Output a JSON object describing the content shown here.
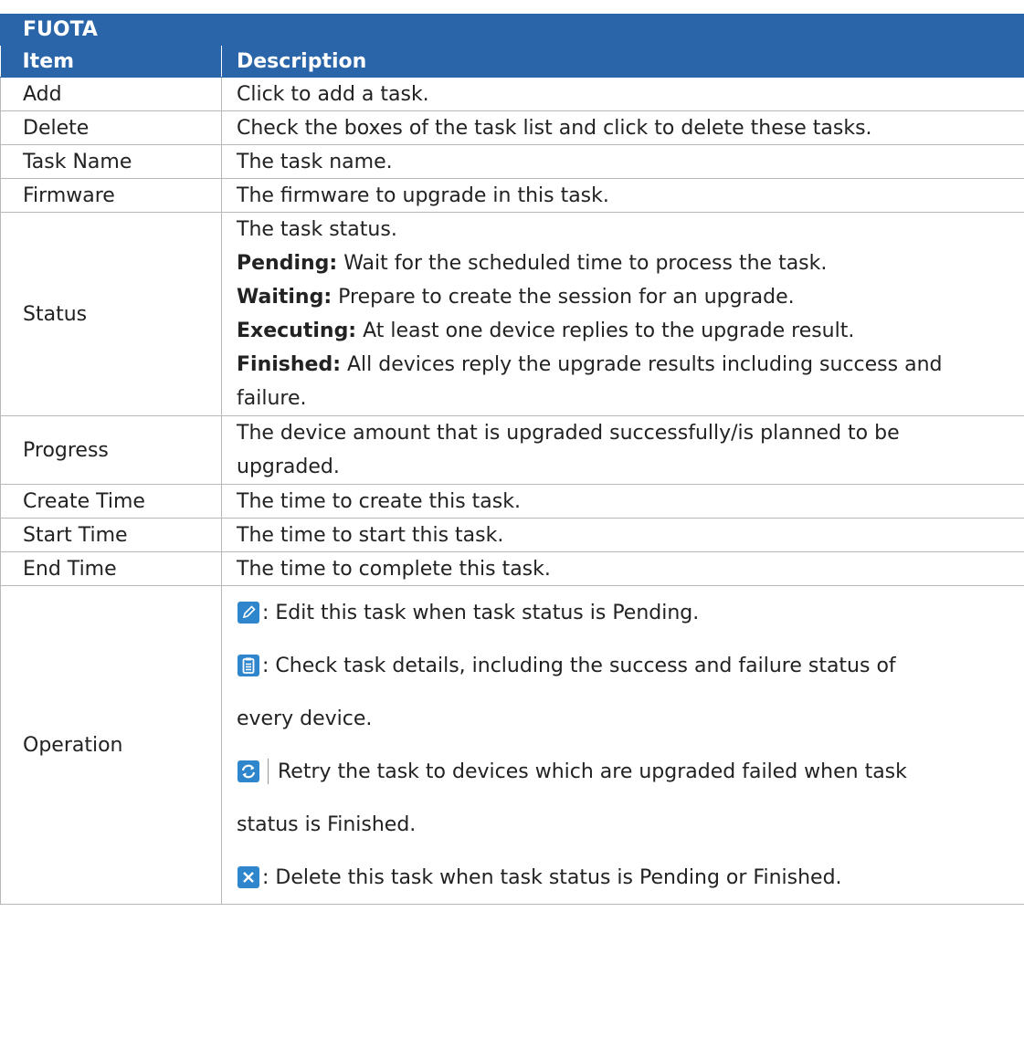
{
  "title": "FUOTA",
  "header": {
    "item": "Item",
    "description": "Description"
  },
  "rows": {
    "add": {
      "item": "Add",
      "desc": "Click to add a task."
    },
    "delete": {
      "item": "Delete",
      "desc": "Check the boxes of the task list and click to delete these tasks."
    },
    "task_name": {
      "item": "Task Name",
      "desc": "The task name."
    },
    "firmware": {
      "item": "Firmware",
      "desc": "The firmware to upgrade in this task."
    },
    "status": {
      "item": "Status",
      "intro": "The task status.",
      "pending_label": "Pending:",
      "pending_text": " Wait for the scheduled time to process the task.",
      "waiting_label": "Waiting:",
      "waiting_text": " Prepare to create the session for an upgrade.",
      "executing_label": "Executing:",
      "executing_text": " At least one device replies to the upgrade result.",
      "finished_label": "Finished:",
      "finished_text_1": " All devices reply the upgrade results including success and",
      "finished_text_2": "failure."
    },
    "progress": {
      "item": "Progress",
      "desc_1": "The device amount that is upgraded successfully/is planned to be",
      "desc_2": "upgraded."
    },
    "create_time": {
      "item": "Create Time",
      "desc": "The time to create this task."
    },
    "start_time": {
      "item": "Start Time",
      "desc": "The time to start this task."
    },
    "end_time": {
      "item": "End Time",
      "desc": "The time to complete this task."
    },
    "operation": {
      "item": "Operation",
      "edit_icon": "edit-icon",
      "edit_text": ": Edit this task when task status is Pending.",
      "details_icon": "clipboard-icon",
      "details_text_1": ": Check task details, including the success and failure status of",
      "details_text_2": "every device.",
      "retry_icon": "refresh-icon",
      "retry_text_1": "Retry the task to devices which are upgraded failed when task",
      "retry_text_2": "status is Finished.",
      "delete_icon": "close-icon",
      "delete_text": ": Delete this task when task status is Pending or Finished."
    }
  },
  "colors": {
    "header": "#2a64a9",
    "icon_blue": "#2f86cc",
    "grid": "#b8b8b8"
  }
}
